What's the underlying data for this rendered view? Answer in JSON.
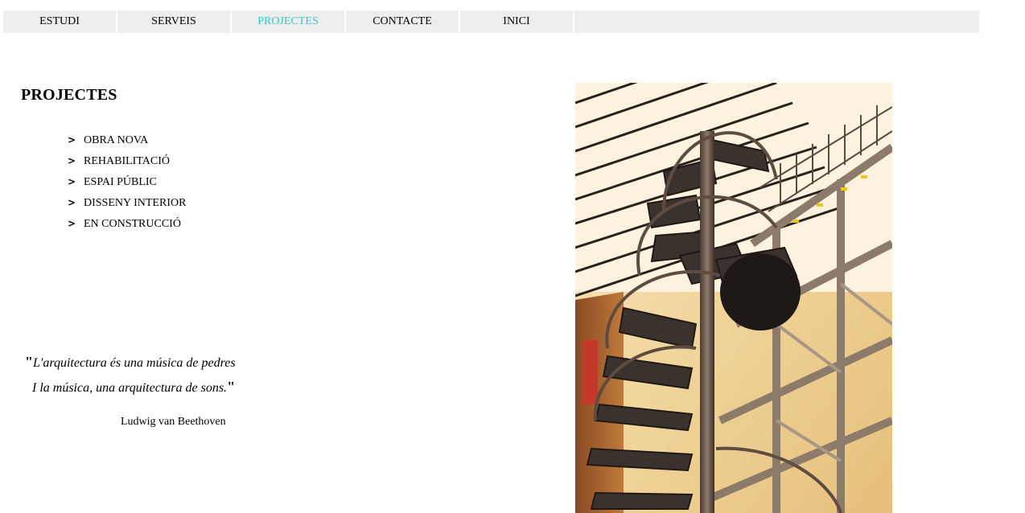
{
  "nav": {
    "items": [
      {
        "label": "ESTUDI",
        "active": false
      },
      {
        "label": "SERVEIS",
        "active": false
      },
      {
        "label": "PROJECTES",
        "active": true
      },
      {
        "label": "CONTACTE",
        "active": false
      },
      {
        "label": "INICI",
        "active": false
      }
    ],
    "active_color": "#3cc4c4",
    "bar_color": "#eeeeee"
  },
  "page": {
    "title": "PROJECTES",
    "categories": [
      {
        "marker": ">",
        "label": "OBRA NOVA"
      },
      {
        "marker": ">",
        "label": "REHABILITACIÓ"
      },
      {
        "marker": ">",
        "label": "ESPAI PÚBLIC"
      },
      {
        "marker": ">",
        "label": "DISSENY INTERIOR"
      },
      {
        "marker": ">",
        "label": "EN CONSTRUCCIÓ"
      }
    ]
  },
  "quote": {
    "open_mark": "\"",
    "line1": "L'arquitectura és una música de pedres",
    "line2": "I la música, una arquitectura de sons.",
    "close_mark": "\"",
    "author": "Ludwig van Beethoven"
  },
  "photo": {
    "subject": "spiral-staircase-photo"
  }
}
